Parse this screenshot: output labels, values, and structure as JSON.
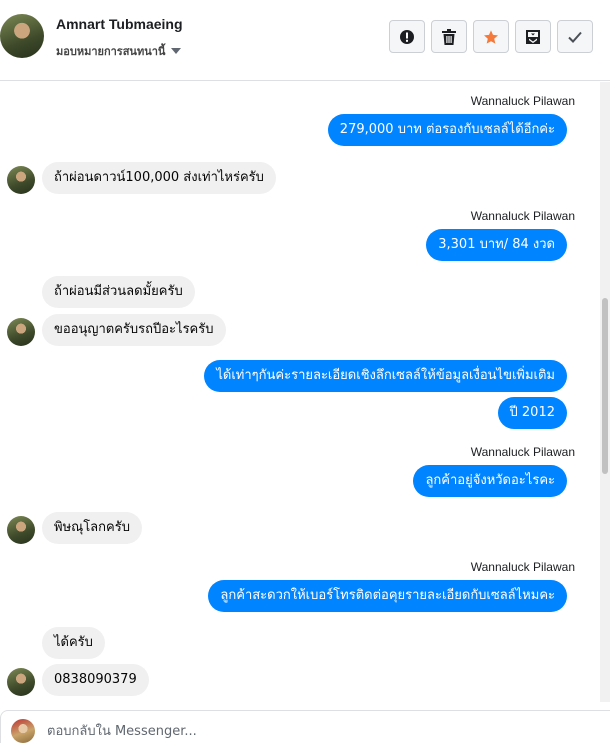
{
  "header": {
    "name": "Amnart Tubmaeing",
    "assign_label": "มอบหมายการสนทนานี้",
    "actions": [
      {
        "name": "spam-button",
        "icon": "exclamation-icon"
      },
      {
        "name": "delete-button",
        "icon": "trash-icon"
      },
      {
        "name": "star-button",
        "icon": "star-icon",
        "color": "#f5793a"
      },
      {
        "name": "archive-button",
        "icon": "archive-icon"
      },
      {
        "name": "done-button",
        "icon": "check-icon"
      }
    ]
  },
  "messages": [
    {
      "dir": "out",
      "sender": "Wannaluck Pilawan",
      "text": "279,000  บาท ต่อรองกับเซลล์ได้อีกค่ะ"
    },
    {
      "dir": "in",
      "text": "ถ้าผ่อนดาวน์100,000 ส่งเท่าไหร่ครับ"
    },
    {
      "dir": "out",
      "sender": "Wannaluck Pilawan",
      "text": "3,301 บาท/ 84 งวด"
    },
    {
      "dir": "in",
      "text": "ถ้าผ่อนมีส่วนลดมั้ยครับ"
    },
    {
      "dir": "in",
      "text": "ขออนุญาตครับรถปีอะไรครับ"
    },
    {
      "dir": "out",
      "text": "ได้เท่าๆกันค่ะรายละเอียดเชิงลึกเซลล์ให้ข้อมูลเงื่อนไขเพิ่มเติม"
    },
    {
      "dir": "out",
      "text": "ปี 2012"
    },
    {
      "dir": "out",
      "sender": "Wannaluck Pilawan",
      "text": "ลูกค้าอยู่จังหวัดอะไรคะ"
    },
    {
      "dir": "in",
      "text": "พิษณุโลกครับ"
    },
    {
      "dir": "out",
      "sender": "Wannaluck Pilawan",
      "text": "ลูกค้าสะดวกให้เบอร์โทรติดต่อคุยรายละเอียดกับเซลล์ไหมคะ"
    },
    {
      "dir": "in",
      "text": "ได้ครับ"
    },
    {
      "dir": "in",
      "text": "0838090379"
    }
  ],
  "composer": {
    "placeholder": "ตอบกลับใน Messenger..."
  }
}
